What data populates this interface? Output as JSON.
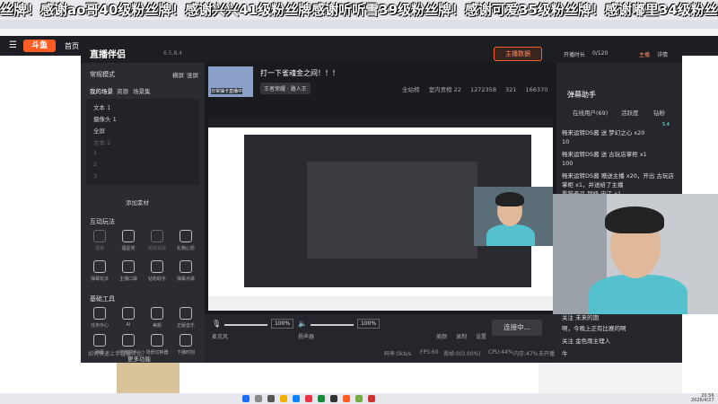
{
  "banner": {
    "text": "丝牌！感谢ao哥40级粉丝牌！感谢兴兴41级粉丝牌感谢听听雪39级粉丝牌！感谢可爱35级粉丝牌！感谢嘟里34级粉丝牌！"
  },
  "site": {
    "logo": "斗鱼",
    "home": "首页"
  },
  "app": {
    "title": "直播伴侣",
    "version": "6.5.8.4",
    "stream_data_btn": "主播数据",
    "mode_label": "常规模式",
    "toggles": [
      "横屏",
      "竖屏"
    ],
    "scene_tabs": [
      "我的场景",
      "资源",
      "场景集"
    ],
    "scenes": [
      {
        "label": "文本 1"
      },
      {
        "label": "摄像头 1"
      },
      {
        "label": "全屏"
      },
      {
        "label": "文本 2"
      },
      {
        "label": "1"
      },
      {
        "label": "2"
      },
      {
        "label": "3"
      }
    ],
    "add_source": "添加素材",
    "interact_title": "互动玩法",
    "interact_tools": [
      "福袋",
      "福星奖",
      "超级福袋",
      "礼物心愿",
      "弹幕玩法",
      "主播口袋",
      "钻粉助手",
      "弹幕点歌"
    ],
    "basic_title": "基础工具",
    "basic_tools": [
      "任务中心",
      "AI",
      "美颜",
      "正版音乐",
      "弹幕",
      "房管助手",
      "场景切换器",
      "下播时刻"
    ],
    "more": "更多功能",
    "room": {
      "title": "打一下雀魂金之间！！！",
      "category": "王者荣耀 · 路人王",
      "thumb_text": "日常抽卡直播中",
      "stats": [
        "全站榜",
        "室内贡榜 22",
        "1272358",
        "321",
        "166370"
      ]
    },
    "bottom": {
      "mic_label": "麦克风",
      "mic_pct": "100%",
      "speaker_label": "扬声器",
      "speaker_pct": "100%",
      "tools": [
        "美颜",
        "录制",
        "设置"
      ],
      "connect_btn": "连接中...",
      "status": [
        "如何快速上手直播伴侣？",
        "码率:0kb/s",
        "FPS:60",
        "丢帧:0(0.00%)",
        "CPU:44%",
        "内存:47%",
        "未开播"
      ]
    }
  },
  "right_panel": {
    "header": [
      "开播时长",
      "0/120",
      "主播",
      "详情"
    ],
    "title": "弹幕助手",
    "tabs": [
      "在线用户(69)",
      "活跃度",
      "钻粉"
    ],
    "messages": [
      "畅来运转DS酱 送 梦幻之心 x20",
      "10",
      "畅来运转DS酱 送 古玩店掌柜 x1",
      "100",
      "畅来运转DS酱 赠送主播 x20，开出 古玩店掌柜 x1，并送给了主播",
      "看猫奋爪  超级  宋江 x1",
      "关注  未来的期",
      "啊，今晚上正有比赛的啊",
      "关注  金色雨主理人",
      "牛"
    ],
    "version_badge": "5.4"
  },
  "taskbar": {
    "time": "20:56",
    "date": "2026/4/27"
  },
  "colors": {
    "accent": "#ff5d23",
    "app_bg": "#25262b",
    "panel_bg": "#2b2c31"
  }
}
